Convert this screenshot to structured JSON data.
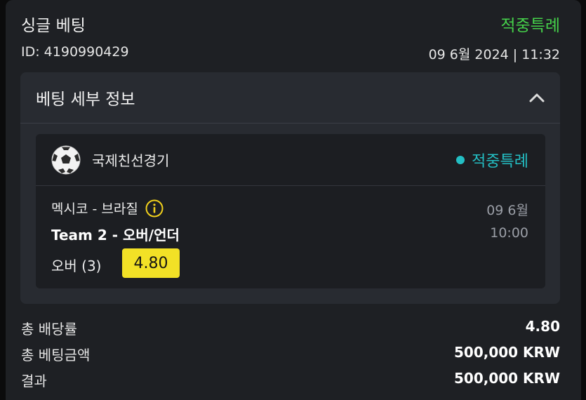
{
  "header": {
    "title": "싱글 베팅",
    "status": "적중특례",
    "bet_id": "ID: 4190990429",
    "datetime": "09 6월 2024 | 11:32"
  },
  "details": {
    "title": "베팅 세부 정보",
    "match": {
      "league": "국제친선경기",
      "status": "적중특례",
      "teams": "멕시코 - 브라질",
      "market": "Team 2 - 오버/언더",
      "selection": "오버 (3)",
      "odds": "4.80",
      "date": "09 6월",
      "time": "10:00"
    }
  },
  "summary": [
    {
      "label": "총 배당률",
      "value": "4.80"
    },
    {
      "label": "총 베팅금액",
      "value": "500,000 KRW"
    },
    {
      "label": "결과",
      "value": "500,000 KRW"
    }
  ],
  "colors": {
    "status_green": "#45d14a",
    "status_teal": "#23bfc4",
    "odds_yellow": "#f2e126"
  }
}
